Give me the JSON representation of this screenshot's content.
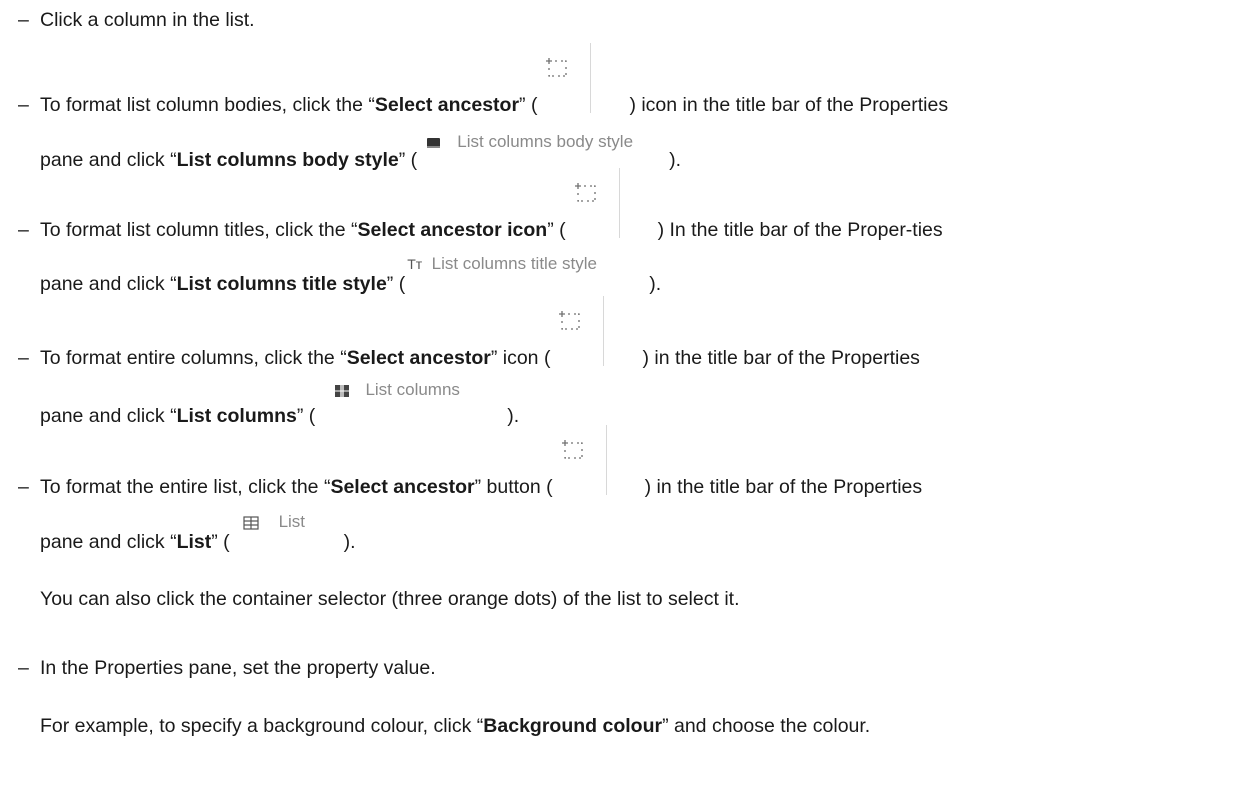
{
  "lines": {
    "l1": "Click a column in the list.",
    "l2a": "To format list column bodies, click the “",
    "l2b": "Select ancestor",
    "l2c": "” (",
    "l2d": ") icon in the title bar of the Properties",
    "l3a": "pane and click “",
    "l3b": "List columns body style",
    "l3c": "” (",
    "l3d": ").",
    "l4a": "To format list column titles, click the “",
    "l4b": "Select ancestor icon",
    "l4c": "” (",
    "l4d": ") In the title bar of the Proper-ties",
    "l5a": "pane and click “",
    "l5b": "List columns title style",
    "l5c": "” (",
    "l5d": ").",
    "l6a": "To format entire columns, click the “",
    "l6b": "Select ancestor",
    "l6c": "” icon (",
    "l6d": ") in the title bar of the Properties",
    "l7a": "pane and click “",
    "l7b": "List columns",
    "l7c": "” (",
    "l7d": ").",
    "l8a": "To format the entire list, click the “",
    "l8b": "Select ancestor",
    "l8c": "” button (",
    "l8d": ") in the title bar of the Properties",
    "l9a": "pane and click “",
    "l9b": "List",
    "l9c": "” (",
    "l9d": ").",
    "l10": "You can also click the container selector (three orange dots) of the list to select it.",
    "l11": "In the Properties pane, set the property value.",
    "l12a": "For example, to specify a background colour, click “",
    "l12b": "Background colour",
    "l12c": "” and choose the colour."
  },
  "icons": {
    "body_style": {
      "icon": "filled-rect-icon",
      "label": "List columns body style"
    },
    "title_style": {
      "icon": "text-style-icon",
      "glyph": "Tт",
      "label": "List columns title style"
    },
    "columns": {
      "icon": "columns-grid-icon",
      "label": "List columns"
    },
    "list": {
      "icon": "table-icon",
      "label": "List"
    }
  },
  "dash": "–",
  "colors": {
    "text": "#1a1a1a",
    "ui_label": "#8a8a8a"
  }
}
